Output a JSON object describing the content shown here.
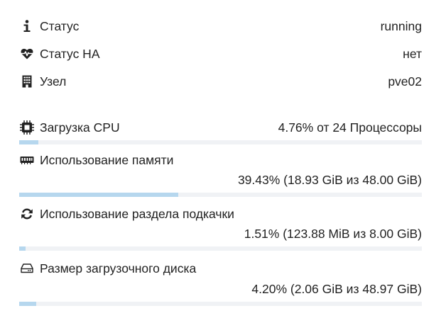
{
  "status": {
    "label": "Статус",
    "value": "running",
    "icon": "info-icon"
  },
  "ha": {
    "label": "Статус HA",
    "value": "нет",
    "icon": "heartbeat-icon"
  },
  "node": {
    "label": "Узел",
    "value": "pve02",
    "icon": "building-icon"
  },
  "cpu": {
    "label": "Загрузка CPU",
    "value": "4.76% от 24 Процессоры",
    "icon": "cpu-icon",
    "usage_fraction": 0.0476
  },
  "memory": {
    "label": "Использование памяти",
    "value": "39.43% (18.93 GiB из 48.00 GiB)",
    "icon": "memory-icon",
    "usage_fraction": 0.3943
  },
  "swap": {
    "label": "Использование раздела подкачки",
    "value": "1.51% (123.88 MiB из 8.00 GiB)",
    "icon": "refresh-icon",
    "usage_fraction": 0.0151
  },
  "bootdisk": {
    "label": "Размер загрузочного диска",
    "value": "4.20% (2.06 GiB из 48.97 GiB)",
    "icon": "hdd-icon",
    "usage_fraction": 0.042
  }
}
